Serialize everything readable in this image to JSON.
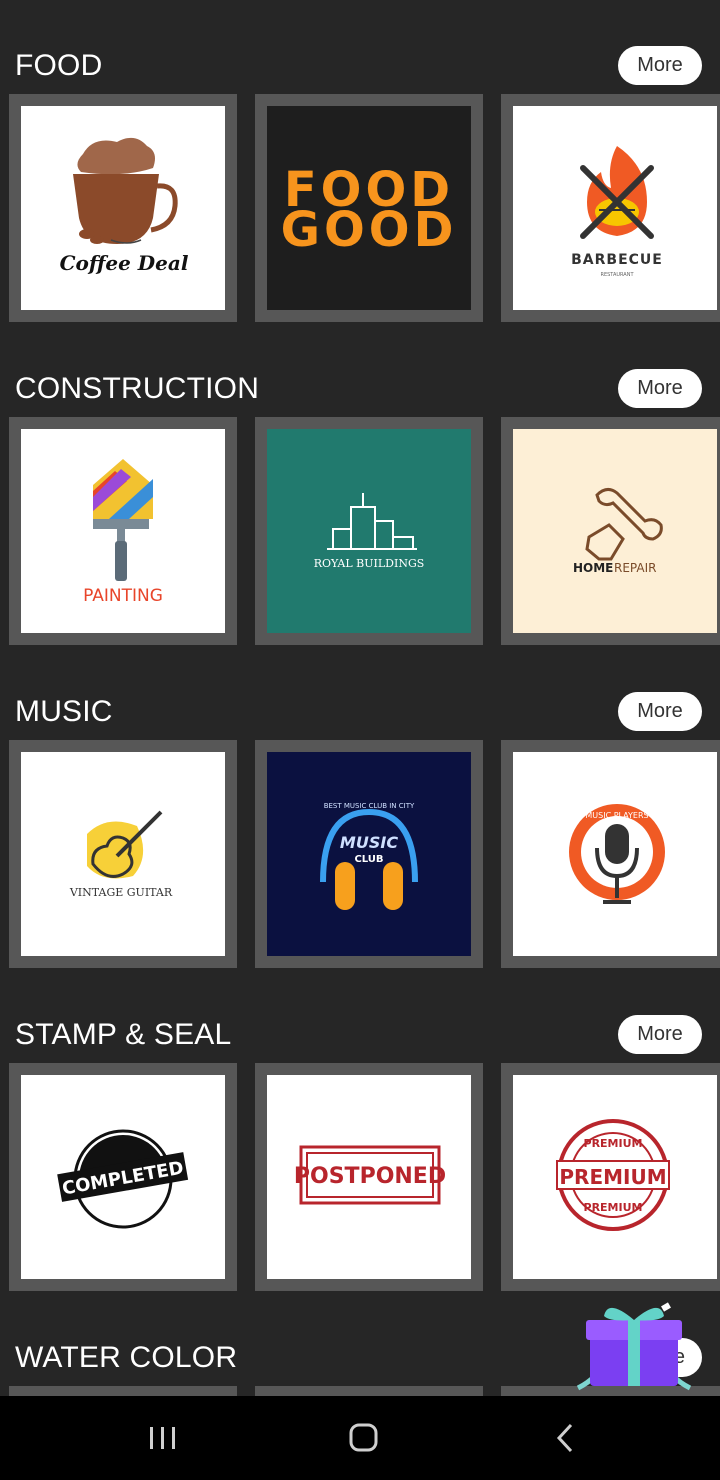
{
  "sections": [
    {
      "title": "FOOD",
      "more_label": "More",
      "tiles": [
        {
          "label": "Coffee Deal",
          "bg": "#ffffff"
        },
        {
          "label_line1": "FOOD",
          "label_line2": "GOOD",
          "bg": "#1e1e1e",
          "accent": "#f7941d"
        },
        {
          "label": "BARBECUE",
          "sub": "RESTAURANT",
          "bg": "#ffffff"
        }
      ]
    },
    {
      "title": "CONSTRUCTION",
      "more_label": "More",
      "tiles": [
        {
          "label": "PAINTING",
          "bg": "#ffffff",
          "accent": "#e8452a"
        },
        {
          "label": "ROYAL BUILDINGS",
          "bg": "#217a6e"
        },
        {
          "label_a": "HOME",
          "label_b": "REPAIR",
          "bg": "#fdefd6"
        }
      ]
    },
    {
      "title": "MUSIC",
      "more_label": "More",
      "tiles": [
        {
          "label": "VINTAGE GUITAR",
          "bg": "#ffffff"
        },
        {
          "arc": "BEST MUSIC CLUB IN CITY",
          "label": "MUSIC",
          "sub": "CLUB",
          "bg": "#0b1140"
        },
        {
          "arc": "MUSIC PLAYERS",
          "bg": "#ffffff",
          "accent": "#f05a24"
        }
      ]
    },
    {
      "title": "STAMP & SEAL",
      "more_label": "More",
      "tiles": [
        {
          "label": "COMPLETED",
          "bg": "#ffffff"
        },
        {
          "label": "POSTPONED",
          "bg": "#ffffff",
          "accent": "#b8252c"
        },
        {
          "label": "PREMIUM",
          "arc_top": "PREMIUM",
          "arc_bottom": "PREMIUM",
          "bg": "#ffffff",
          "accent": "#b8252c"
        }
      ]
    },
    {
      "title": "WATER COLOR",
      "more_label": "e"
    }
  ],
  "colors": {
    "background": "#262626",
    "tile_frame": "#575757",
    "navbar": "#000000"
  },
  "icons": {
    "gift": "gift-box-icon",
    "nav_recents": "recent-apps-icon",
    "nav_home": "home-icon",
    "nav_back": "back-icon"
  }
}
